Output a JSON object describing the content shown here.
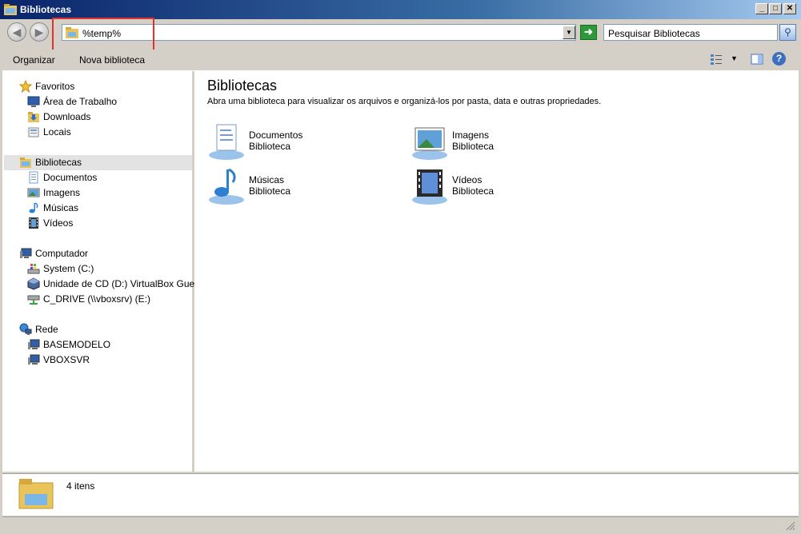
{
  "window": {
    "title": "Bibliotecas",
    "minimize": "_",
    "maximize": "□",
    "close": "✕"
  },
  "address": {
    "value": "%temp%",
    "search_placeholder": "Pesquisar Bibliotecas"
  },
  "toolbar": {
    "organize": "Organizar",
    "new_library": "Nova biblioteca"
  },
  "sidebar": {
    "favorites": {
      "label": "Favoritos",
      "items": [
        "Área de Trabalho",
        "Downloads",
        "Locais"
      ]
    },
    "libraries": {
      "label": "Bibliotecas",
      "items": [
        "Documentos",
        "Imagens",
        "Músicas",
        "Vídeos"
      ]
    },
    "computer": {
      "label": "Computador",
      "items": [
        "System (C:)",
        "Unidade de CD (D:) VirtualBox Guest A",
        "C_DRIVE (\\\\vboxsrv) (E:)"
      ]
    },
    "network": {
      "label": "Rede",
      "items": [
        "BASEMODELO",
        "VBOXSVR"
      ]
    }
  },
  "content": {
    "title": "Bibliotecas",
    "subtitle": "Abra uma biblioteca para visualizar os arquivos e organizá-los por pasta, data e outras propriedades.",
    "libraries": [
      {
        "name": "Documentos",
        "type": "Biblioteca",
        "icon": "documents-library-icon"
      },
      {
        "name": "Imagens",
        "type": "Biblioteca",
        "icon": "pictures-library-icon"
      },
      {
        "name": "Músicas",
        "type": "Biblioteca",
        "icon": "music-library-icon"
      },
      {
        "name": "Vídeos",
        "type": "Biblioteca",
        "icon": "videos-library-icon"
      }
    ]
  },
  "details": {
    "count": "4 itens"
  },
  "colors": {
    "titlebar": "#0a246a",
    "highlight": "#e03030",
    "selected": "#e3e3e3"
  }
}
